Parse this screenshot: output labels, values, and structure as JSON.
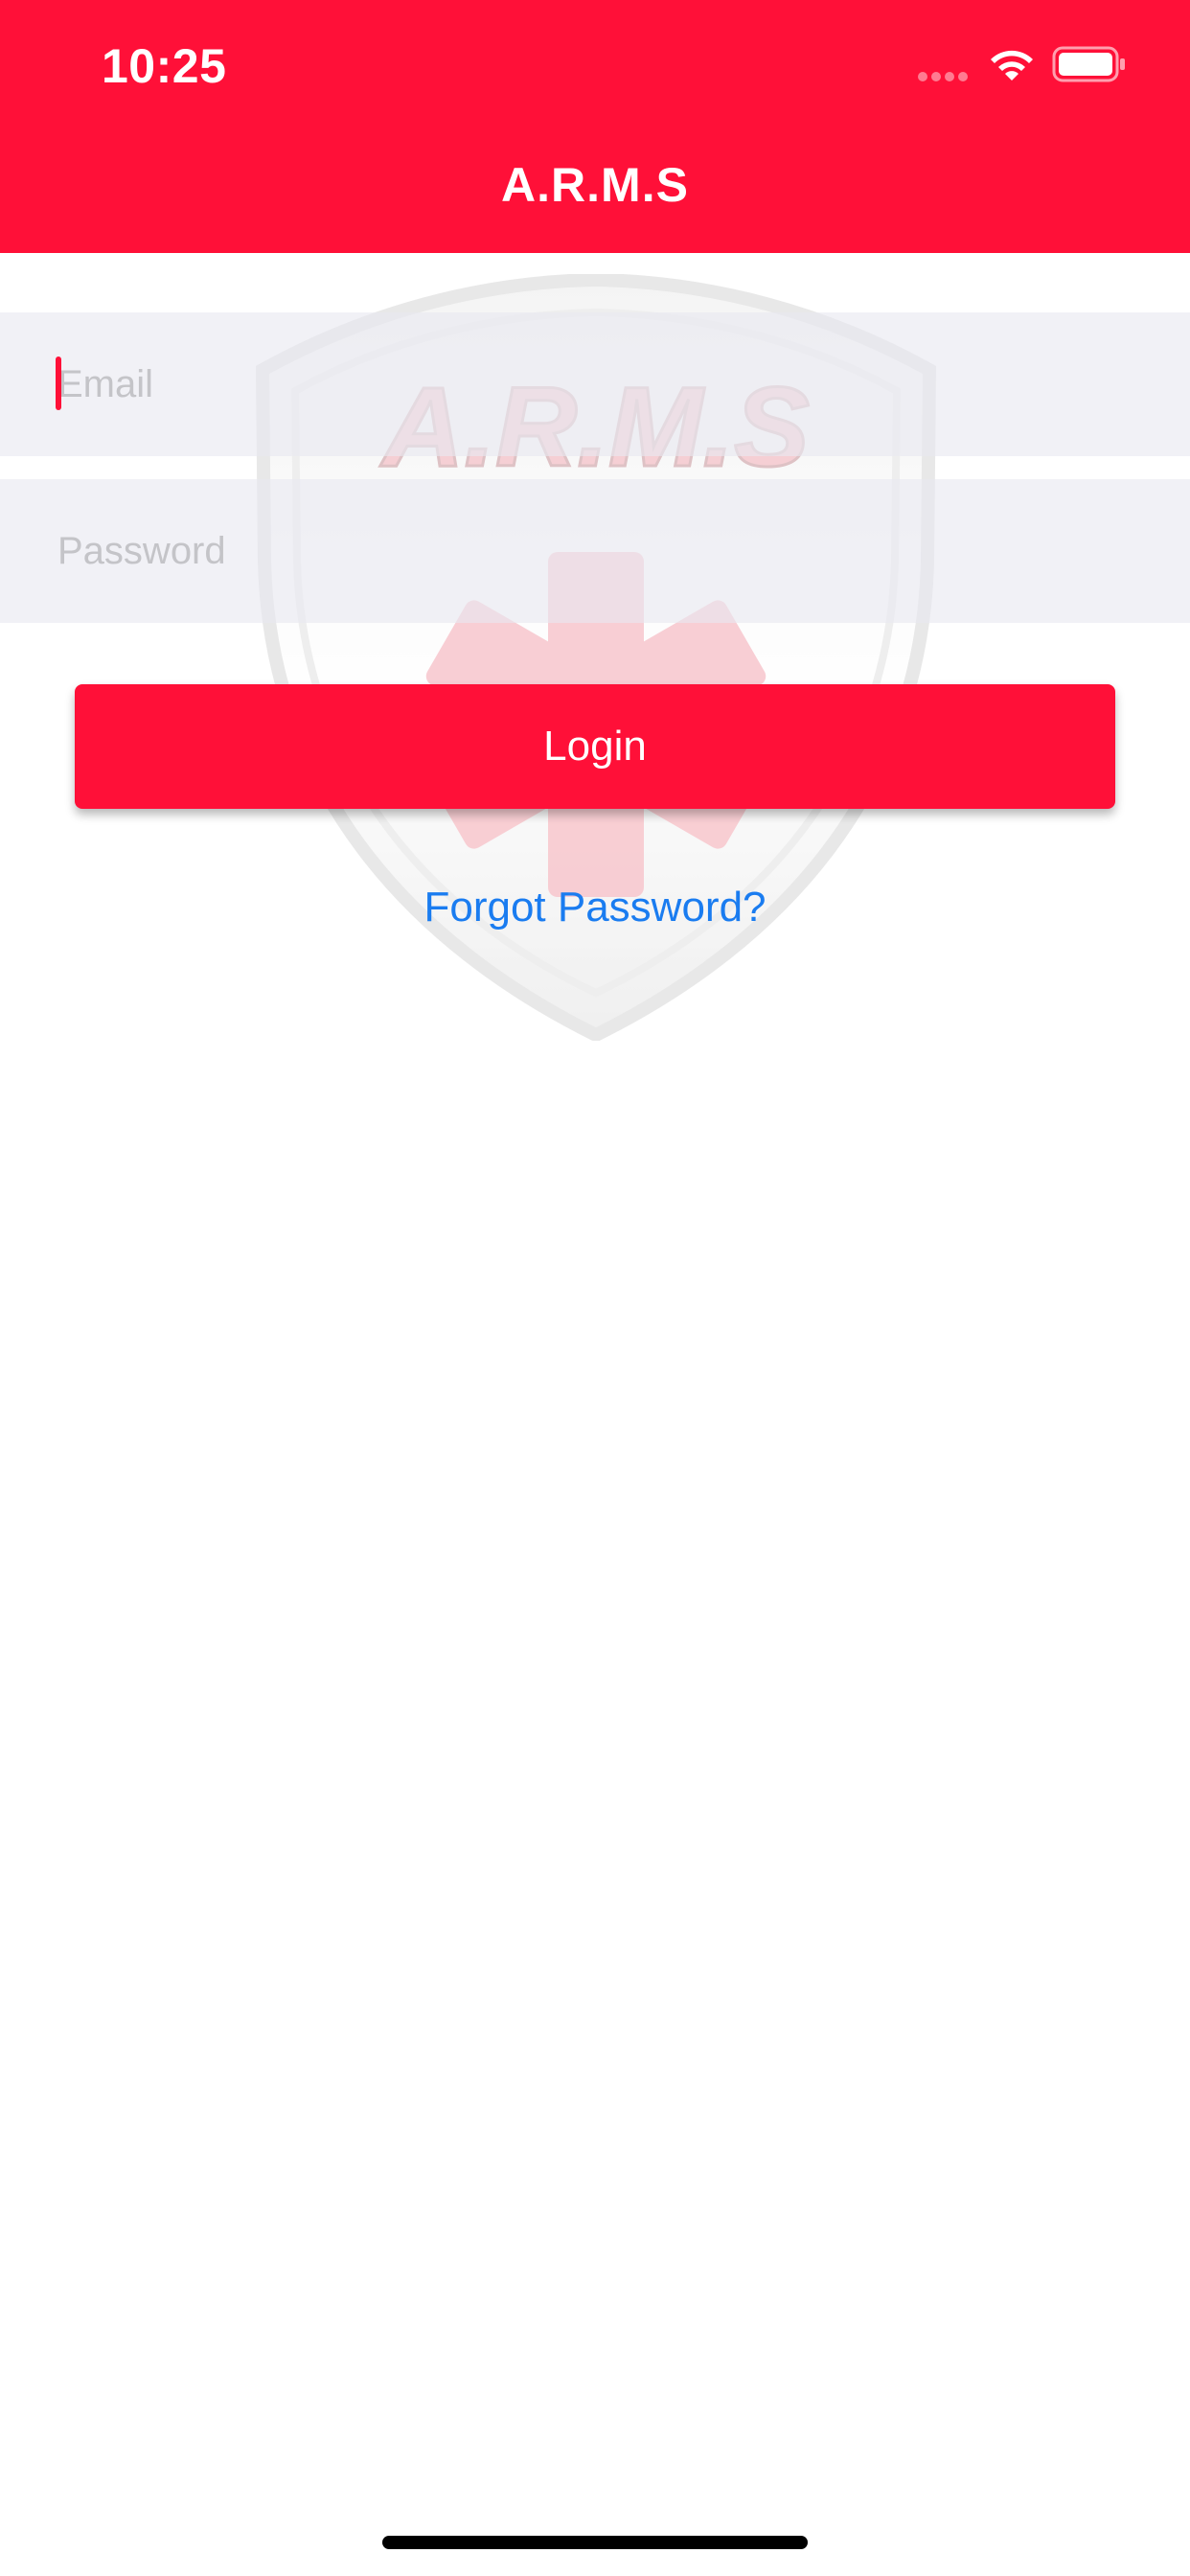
{
  "status_bar": {
    "time": "10:25",
    "signal_icon": "cellular-signal-icon",
    "wifi_icon": "wifi-icon",
    "battery_icon": "battery-icon"
  },
  "nav": {
    "title": "A.R.M.S"
  },
  "watermark": {
    "logo_text": "A.R.M.S",
    "icon": "shield-medical-star-logo"
  },
  "form": {
    "email_placeholder": "Email",
    "email_value": "",
    "password_placeholder": "Password",
    "password_value": "",
    "login_label": "Login",
    "forgot_label": "Forgot Password?"
  },
  "colors": {
    "brand_red": "#ff1038",
    "link_blue": "#1a7cf0",
    "field_bg": "#efeff4"
  }
}
